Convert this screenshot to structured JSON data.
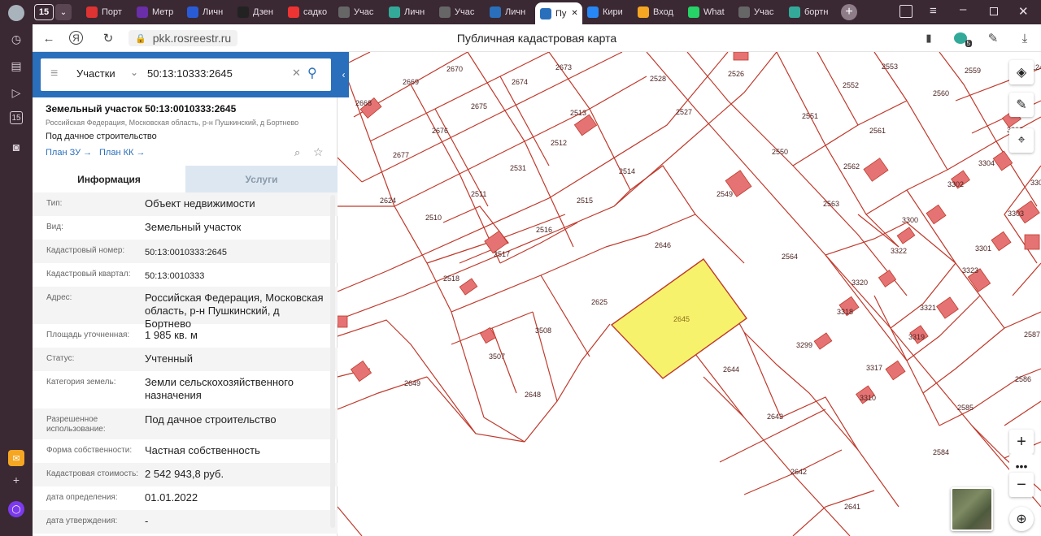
{
  "browser": {
    "tab_count": "15",
    "tabs": [
      {
        "label": "Порт",
        "color": "#d33"
      },
      {
        "label": "Метр",
        "color": "#6a2ea8"
      },
      {
        "label": "Личн",
        "color": "#2a5bd7"
      },
      {
        "label": "Дзен",
        "color": "#222"
      },
      {
        "label": "садко",
        "color": "#e33"
      },
      {
        "label": "Учас",
        "color": "#666"
      },
      {
        "label": "Личн",
        "color": "#3a9"
      },
      {
        "label": "Учас",
        "color": "#666"
      },
      {
        "label": "Личн",
        "color": "#2a6fbb"
      },
      {
        "label": "Пу",
        "color": "#2a6fbb"
      },
      {
        "label": "Кири",
        "color": "#2787f5"
      },
      {
        "label": "Вход",
        "color": "#f5a623"
      },
      {
        "label": "What",
        "color": "#25d366"
      },
      {
        "label": "Учас",
        "color": "#666"
      },
      {
        "label": "бортн",
        "color": "#3a9"
      }
    ],
    "url": "pkk.rosreestr.ru",
    "page_title": "Публичная кадастровая карта",
    "download_badge": "5"
  },
  "search": {
    "type_label": "Участки",
    "query": "50:13:10333:2645"
  },
  "parcel": {
    "title": "Земельный участок 50:13:0010333:2645",
    "address_small": "Российская Федерация, Московская область, р-н Пушкинский, д Бортнево",
    "purpose": "Под дачное строительство",
    "plan_zu": "План ЗУ",
    "plan_kk": "План КК"
  },
  "tabs": {
    "info": "Информация",
    "services": "Услуги"
  },
  "info_rows": [
    {
      "k": "Тип:",
      "v": "Объект недвижимости"
    },
    {
      "k": "Вид:",
      "v": "Земельный участок"
    },
    {
      "k": "Кадастровый номер:",
      "v": "50:13:0010333:2645"
    },
    {
      "k": "Кадастровый квартал:",
      "v": "50:13:0010333"
    },
    {
      "k": "Адрес:",
      "v": "Российская Федерация, Московская область, р-н Пушкинский, д Бортнево"
    },
    {
      "k": "Площадь уточненная:",
      "v": "1 985 кв. м"
    },
    {
      "k": "Статус:",
      "v": "Учтенный"
    },
    {
      "k": "Категория земель:",
      "v": "Земли сельскохозяйственного назначения"
    },
    {
      "k": "Разрешенное использование:",
      "v": "Под дачное строительство"
    },
    {
      "k": "Форма собственности:",
      "v": "Частная собственность"
    },
    {
      "k": "Кадастровая стоимость:",
      "v": "2 542 943,8 руб."
    },
    {
      "k": "дата определения:",
      "v": "01.01.2022"
    },
    {
      "k": "дата утверждения:",
      "v": "-"
    }
  ],
  "map": {
    "selected_parcel": "2645",
    "labels": [
      "2668",
      "2669",
      "2670",
      "2674",
      "2673",
      "2528",
      "2526",
      "2552",
      "2553",
      "2559",
      "2560",
      "2675",
      "2676",
      "2677",
      "2513",
      "2512",
      "2527",
      "2551",
      "2561",
      "2550",
      "2562",
      "2531",
      "2514",
      "2549",
      "2624",
      "2511",
      "2510",
      "2515",
      "2516",
      "2517",
      "2646",
      "2563",
      "2564",
      "2518",
      "2625",
      "3508",
      "3507",
      "2649",
      "2648",
      "2644",
      "2643",
      "2642",
      "2641",
      "3318",
      "3299",
      "3319",
      "3317",
      "3310",
      "3320",
      "3321",
      "3322",
      "3300",
      "3302",
      "3301",
      "3303",
      "3304",
      "3306",
      "3305",
      "3323",
      "2587",
      "2586",
      "2585",
      "2584",
      "3124"
    ],
    "parcel_line_color": "#c0392b",
    "selected_fill": "#f7f26b"
  }
}
